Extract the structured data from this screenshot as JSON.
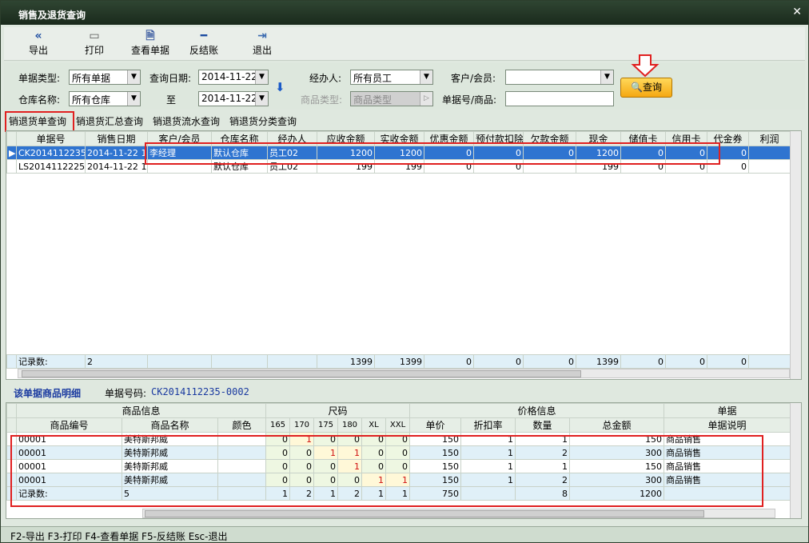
{
  "window": {
    "title": "销售及退货查询",
    "close": "✕"
  },
  "toolbar": {
    "export": "导出",
    "print": "打印",
    "view": "查看单据",
    "unsettle": "反结账",
    "exit": "退出"
  },
  "filter": {
    "doc_type_label": "单据类型:",
    "doc_type_value": "所有单据",
    "query_date_label": "查询日期:",
    "date_from": "2014-11-22",
    "handler_label": "经办人:",
    "handler_value": "所有员工",
    "customer_label": "客户/会员:",
    "customer_value": "",
    "warehouse_label": "仓库名称:",
    "warehouse_value": "所有仓库",
    "to_label": "至",
    "date_to": "2014-11-22",
    "goods_type_label": "商品类型:",
    "goods_type_value": "商品类型",
    "doc_no_label": "单据号/商品:",
    "doc_no_value": "",
    "query_button": "查询"
  },
  "tabs": [
    "销退货单查询",
    "销退货汇总查询",
    "销退货流水查询",
    "销退货分类查询"
  ],
  "master": {
    "headers": [
      "单据号",
      "销售日期",
      "客户/会员",
      "仓库名称",
      "经办人",
      "应收金额",
      "实收金额",
      "优惠金额",
      "预付款扣除",
      "欠款金额",
      "现金",
      "储值卡",
      "信用卡",
      "代金券",
      "利润"
    ],
    "rows": [
      [
        "CK2014112235-0",
        "2014-11-22",
        "1",
        "李经理",
        "默认仓库",
        "员工02",
        "1200",
        "1200",
        "0",
        "0",
        "0",
        "1200",
        "0",
        "0",
        "0"
      ],
      [
        "LS2014112225-0",
        "2014-11-22",
        "1",
        "",
        "默认仓库",
        "员工02",
        "199",
        "199",
        "0",
        "0",
        "",
        "199",
        "0",
        "0",
        "0"
      ]
    ],
    "summary": [
      "记录数:",
      "2",
      "",
      "",
      "",
      "1399",
      "1399",
      "0",
      "0",
      "0",
      "1399",
      "0",
      "0",
      "0"
    ]
  },
  "detail": {
    "title": "该单据商品明细",
    "doc_no_label": "单据号码:",
    "doc_no_value": "CK2014112235-0002",
    "group_headers": {
      "goods": "商品信息",
      "size": "尺码",
      "price": "价格信息",
      "doc": "单据"
    },
    "headers": [
      "商品编号",
      "商品名称",
      "颜色",
      "165",
      "170",
      "175",
      "180",
      "XL",
      "XXL",
      "单价",
      "折扣率",
      "数量",
      "总金额",
      "单据说明"
    ],
    "rows": [
      [
        "00001",
        "美特斯邦威",
        "",
        "0",
        "1",
        "0",
        "0",
        "0",
        "0",
        "150",
        "1",
        "1",
        "150",
        "商品销售"
      ],
      [
        "00001",
        "美特斯邦威",
        "",
        "0",
        "0",
        "1",
        "1",
        "0",
        "0",
        "150",
        "1",
        "2",
        "300",
        "商品销售"
      ],
      [
        "00001",
        "美特斯邦威",
        "",
        "0",
        "0",
        "0",
        "1",
        "0",
        "0",
        "150",
        "1",
        "1",
        "150",
        "商品销售"
      ],
      [
        "00001",
        "美特斯邦威",
        "",
        "0",
        "0",
        "0",
        "0",
        "1",
        "1",
        "150",
        "1",
        "2",
        "300",
        "商品销售"
      ]
    ],
    "summary": [
      "记录数:",
      "5",
      "",
      "1",
      "2",
      "1",
      "2",
      "1",
      "1",
      "750",
      "",
      "8",
      "1200",
      ""
    ]
  },
  "statusbar": "F2-导出 F3-打印 F4-查看单据 F5-反结账 Esc-退出"
}
